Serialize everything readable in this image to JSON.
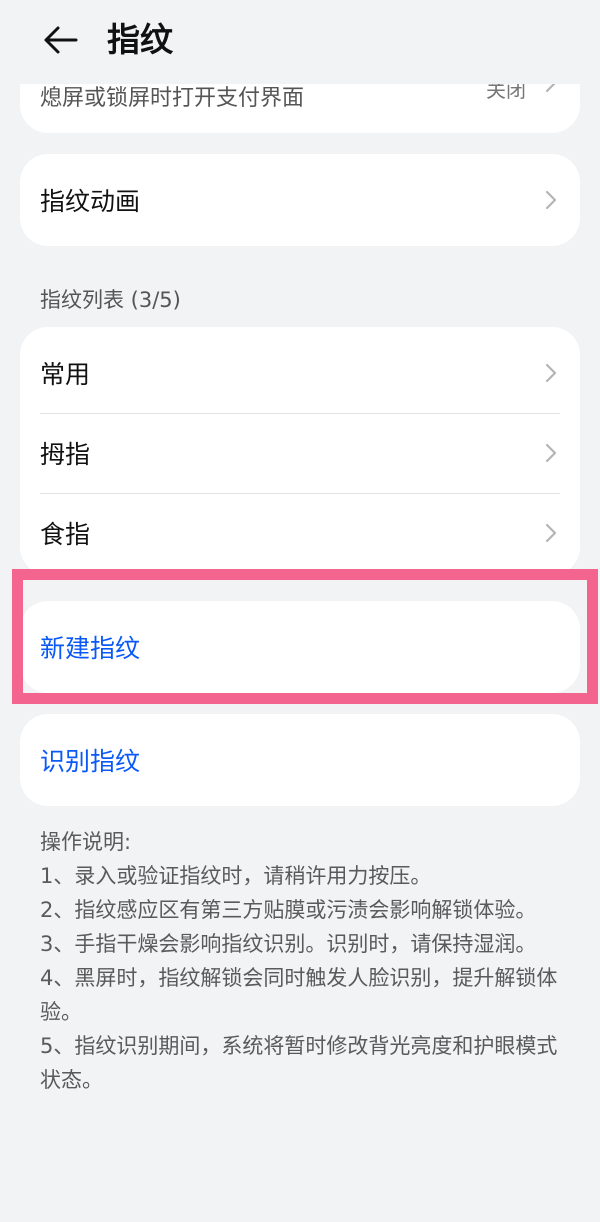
{
  "header": {
    "title": "指纹",
    "back_icon": "arrow-left-icon"
  },
  "top_card": {
    "subtitle": "熄屏或锁屏时打开支付界面",
    "partial_value": "关闭"
  },
  "animation_card": {
    "label": "指纹动画"
  },
  "fingerprint_list": {
    "section_label": "指纹列表 (3/5)",
    "items": [
      {
        "label": "常用"
      },
      {
        "label": "拇指"
      },
      {
        "label": "食指"
      }
    ]
  },
  "actions": {
    "new_label": "新建指纹",
    "identify_label": "识别指纹",
    "accent_color": "#0a59f7"
  },
  "instructions": {
    "title": "操作说明:",
    "lines": [
      "1、录入或验证指纹时，请稍许用力按压。",
      "2、指纹感应区有第三方贴膜或污渍会影响解锁体验。",
      "3、手指干燥会影响指纹识别。识别时，请保持湿润。",
      "4、黑屏时，指纹解锁会同时触发人脸识别，提升解锁体验。",
      "5、指纹识别期间，系统将暂时修改背光亮度和护眼模式状态。"
    ]
  },
  "highlight_color": "#f3648f"
}
